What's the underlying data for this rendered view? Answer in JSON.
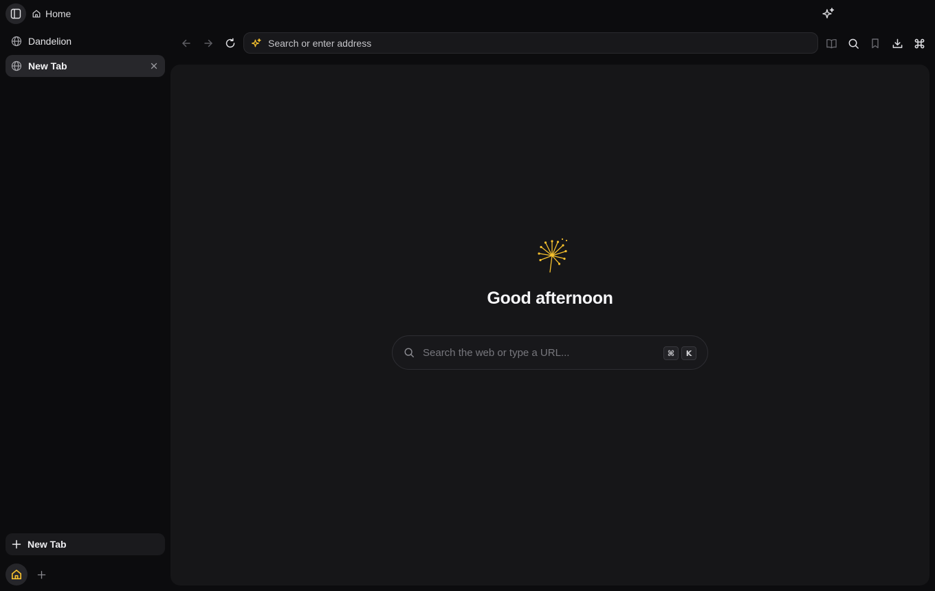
{
  "header": {
    "breadcrumb_label": "Home",
    "sidebar_toggle_icon": "sidebar-panel-icon",
    "ai_icon": "sparkles-icon"
  },
  "sidebar": {
    "tabs": [
      {
        "label": "Dandelion",
        "icon": "globe-icon",
        "active": false
      },
      {
        "label": "New Tab",
        "icon": "globe-icon",
        "active": true
      }
    ],
    "new_tab_label": "New Tab",
    "spaces": [
      {
        "icon": "home-icon",
        "active": true
      }
    ]
  },
  "toolbar": {
    "address_placeholder": "Search or enter address",
    "buttons": [
      "back-icon",
      "forward-icon",
      "reload-icon",
      "reader-icon",
      "search-icon",
      "bookmark-icon",
      "download-icon",
      "command-icon"
    ]
  },
  "content": {
    "greeting": "Good afternoon",
    "search_placeholder": "Search the web or type a URL...",
    "shortcut_keys": [
      "⌘",
      "K"
    ]
  },
  "colors": {
    "accent": "#f5c02e",
    "background": "#0c0c0e",
    "panel": "#161618"
  }
}
